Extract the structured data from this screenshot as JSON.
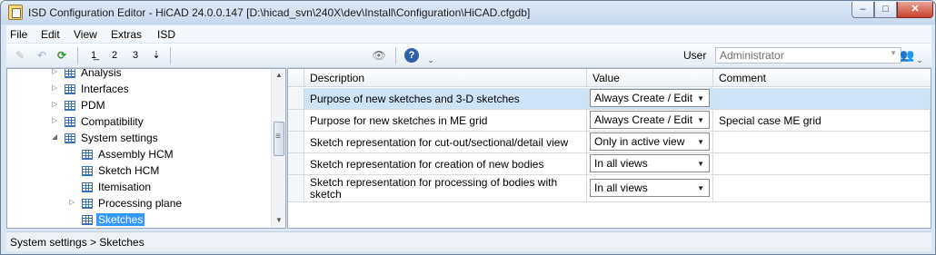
{
  "window": {
    "title": "ISD Configuration Editor  - HiCAD 24.0.0.147 [D:\\hicad_svn\\240X\\dev\\Install\\Configuration\\HiCAD.cfgdb]",
    "min_glyph": "–",
    "max_glyph": "□",
    "close_glyph": "✕"
  },
  "menu": [
    "File",
    "Edit",
    "View",
    "Extras",
    "ISD"
  ],
  "toolbar": {
    "user_label": "User",
    "user_value": "Administrator",
    "icons": {
      "pencil": "✎",
      "undo": "↶",
      "refresh": "⟳",
      "level1": "1̲",
      "level2": "2",
      "level3": "3",
      "level4": "⇣",
      "find": "👁",
      "help": "?",
      "grip": "⌄",
      "users": "👥",
      "dropdown": "▼"
    }
  },
  "tree": {
    "items": [
      {
        "label": "Analysis",
        "expander": "▷"
      },
      {
        "label": "Interfaces",
        "expander": "▷"
      },
      {
        "label": "PDM",
        "expander": "▷"
      },
      {
        "label": "Compatibility",
        "expander": "▷"
      },
      {
        "label": "System settings",
        "expander": "◢"
      },
      {
        "label": "Assembly HCM",
        "expander": ""
      },
      {
        "label": "Sketch HCM",
        "expander": ""
      },
      {
        "label": "Itemisation",
        "expander": ""
      },
      {
        "label": "Processing plane",
        "expander": "▷"
      },
      {
        "label": "Sketches",
        "expander": ""
      }
    ],
    "scroll_up": "▲",
    "scroll_down": "▼"
  },
  "grid": {
    "columns": [
      "Description",
      "Value",
      "Comment"
    ],
    "rows": [
      {
        "description": "Purpose of new sketches and 3-D sketches",
        "value": "Always Create / Edit",
        "comment": ""
      },
      {
        "description": "Purpose for new sketches in ME grid",
        "value": "Always Create / Edit",
        "comment": "Special case ME grid"
      },
      {
        "description": "Sketch representation for cut-out/sectional/detail view",
        "value": "Only in active view",
        "comment": ""
      },
      {
        "description": "Sketch representation for creation of new bodies",
        "value": "In all views",
        "comment": ""
      },
      {
        "description": "Sketch representation for processing of bodies with sketch",
        "value": "In all views",
        "comment": ""
      }
    ],
    "dropdown_arrow": "▼"
  },
  "status": {
    "text": "System settings > Sketches"
  }
}
